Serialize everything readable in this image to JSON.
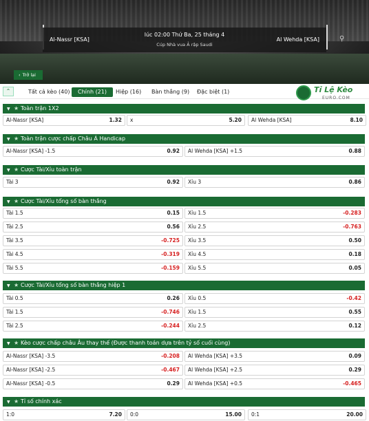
{
  "header": {
    "home_team": "Al-Nassr [KSA]",
    "away_team": "Al Wehda [KSA]",
    "datetime": "lúc 02:00 Thứ Ba, 25 tháng 4",
    "competition": "Cúp Nhà vua Ả rập Saudi",
    "back_label": "Trở lại"
  },
  "brand": {
    "title": "Tỉ Lệ Kèo",
    "subtitle": "EURO.COM"
  },
  "tabs": [
    {
      "label": "Tất cả kèo (40)"
    },
    {
      "label": "Chính (21)",
      "active": true
    },
    {
      "label": "Hiệp (16)"
    },
    {
      "label": "Bàn thắng (9)"
    },
    {
      "label": "Đặc biệt (1)"
    }
  ],
  "colors": {
    "accent": "#1a6b33",
    "negative": "#d62020"
  },
  "sections": {
    "s1": {
      "title": "Toàn trận 1X2",
      "rows": [
        [
          "Al-Nassr [KSA]",
          "1.32",
          "x",
          "5.20",
          "Al Wehda [KSA]",
          "8.10"
        ]
      ]
    },
    "s2": {
      "title": "Toàn trận cược chấp Châu Á Handicap",
      "rows": [
        [
          "Al-Nassr [KSA] -1.5",
          "0.92",
          "Al Wehda [KSA] +1.5",
          "0.88"
        ]
      ]
    },
    "s3": {
      "title": "Cược Tài/Xỉu toàn trận",
      "rows": [
        [
          "Tài 3",
          "0.92",
          "Xỉu 3",
          "0.86"
        ]
      ]
    },
    "s4": {
      "title": "Cược Tài/Xỉu tổng số bàn thắng",
      "rows": [
        [
          "Tài 1.5",
          "0.15",
          "Xỉu 1.5",
          "-0.283"
        ],
        [
          "Tài 2.5",
          "0.56",
          "Xỉu 2.5",
          "-0.763"
        ],
        [
          "Tài 3.5",
          "-0.725",
          "Xỉu 3.5",
          "0.50"
        ],
        [
          "Tài 4.5",
          "-0.319",
          "Xỉu 4.5",
          "0.18"
        ],
        [
          "Tài 5.5",
          "-0.159",
          "Xỉu 5.5",
          "0.05"
        ]
      ]
    },
    "s5": {
      "title": "Cược Tài/Xỉu tổng số bàn thắng hiệp 1",
      "rows": [
        [
          "Tài 0.5",
          "0.26",
          "Xỉu 0.5",
          "-0.42"
        ],
        [
          "Tài 1.5",
          "-0.746",
          "Xỉu 1.5",
          "0.55"
        ],
        [
          "Tài 2.5",
          "-0.244",
          "Xỉu 2.5",
          "0.12"
        ]
      ]
    },
    "s6": {
      "title": "Kèo cược chấp châu Âu thay thế (Được thanh toán dựa trên tỷ số cuối cùng)",
      "rows": [
        [
          "Al-Nassr [KSA] -3.5",
          "-0.208",
          "Al Wehda [KSA] +3.5",
          "0.09"
        ],
        [
          "Al-Nassr [KSA] -2.5",
          "-0.467",
          "Al Wehda [KSA] +2.5",
          "0.29"
        ],
        [
          "Al-Nassr [KSA] -0.5",
          "0.29",
          "Al Wehda [KSA] +0.5",
          "-0.465"
        ]
      ]
    },
    "s7": {
      "title": "Tỉ số chính xác",
      "rows": [
        [
          "1:0",
          "7.20",
          "0:0",
          "15.00",
          "0:1",
          "20.00"
        ]
      ]
    }
  }
}
